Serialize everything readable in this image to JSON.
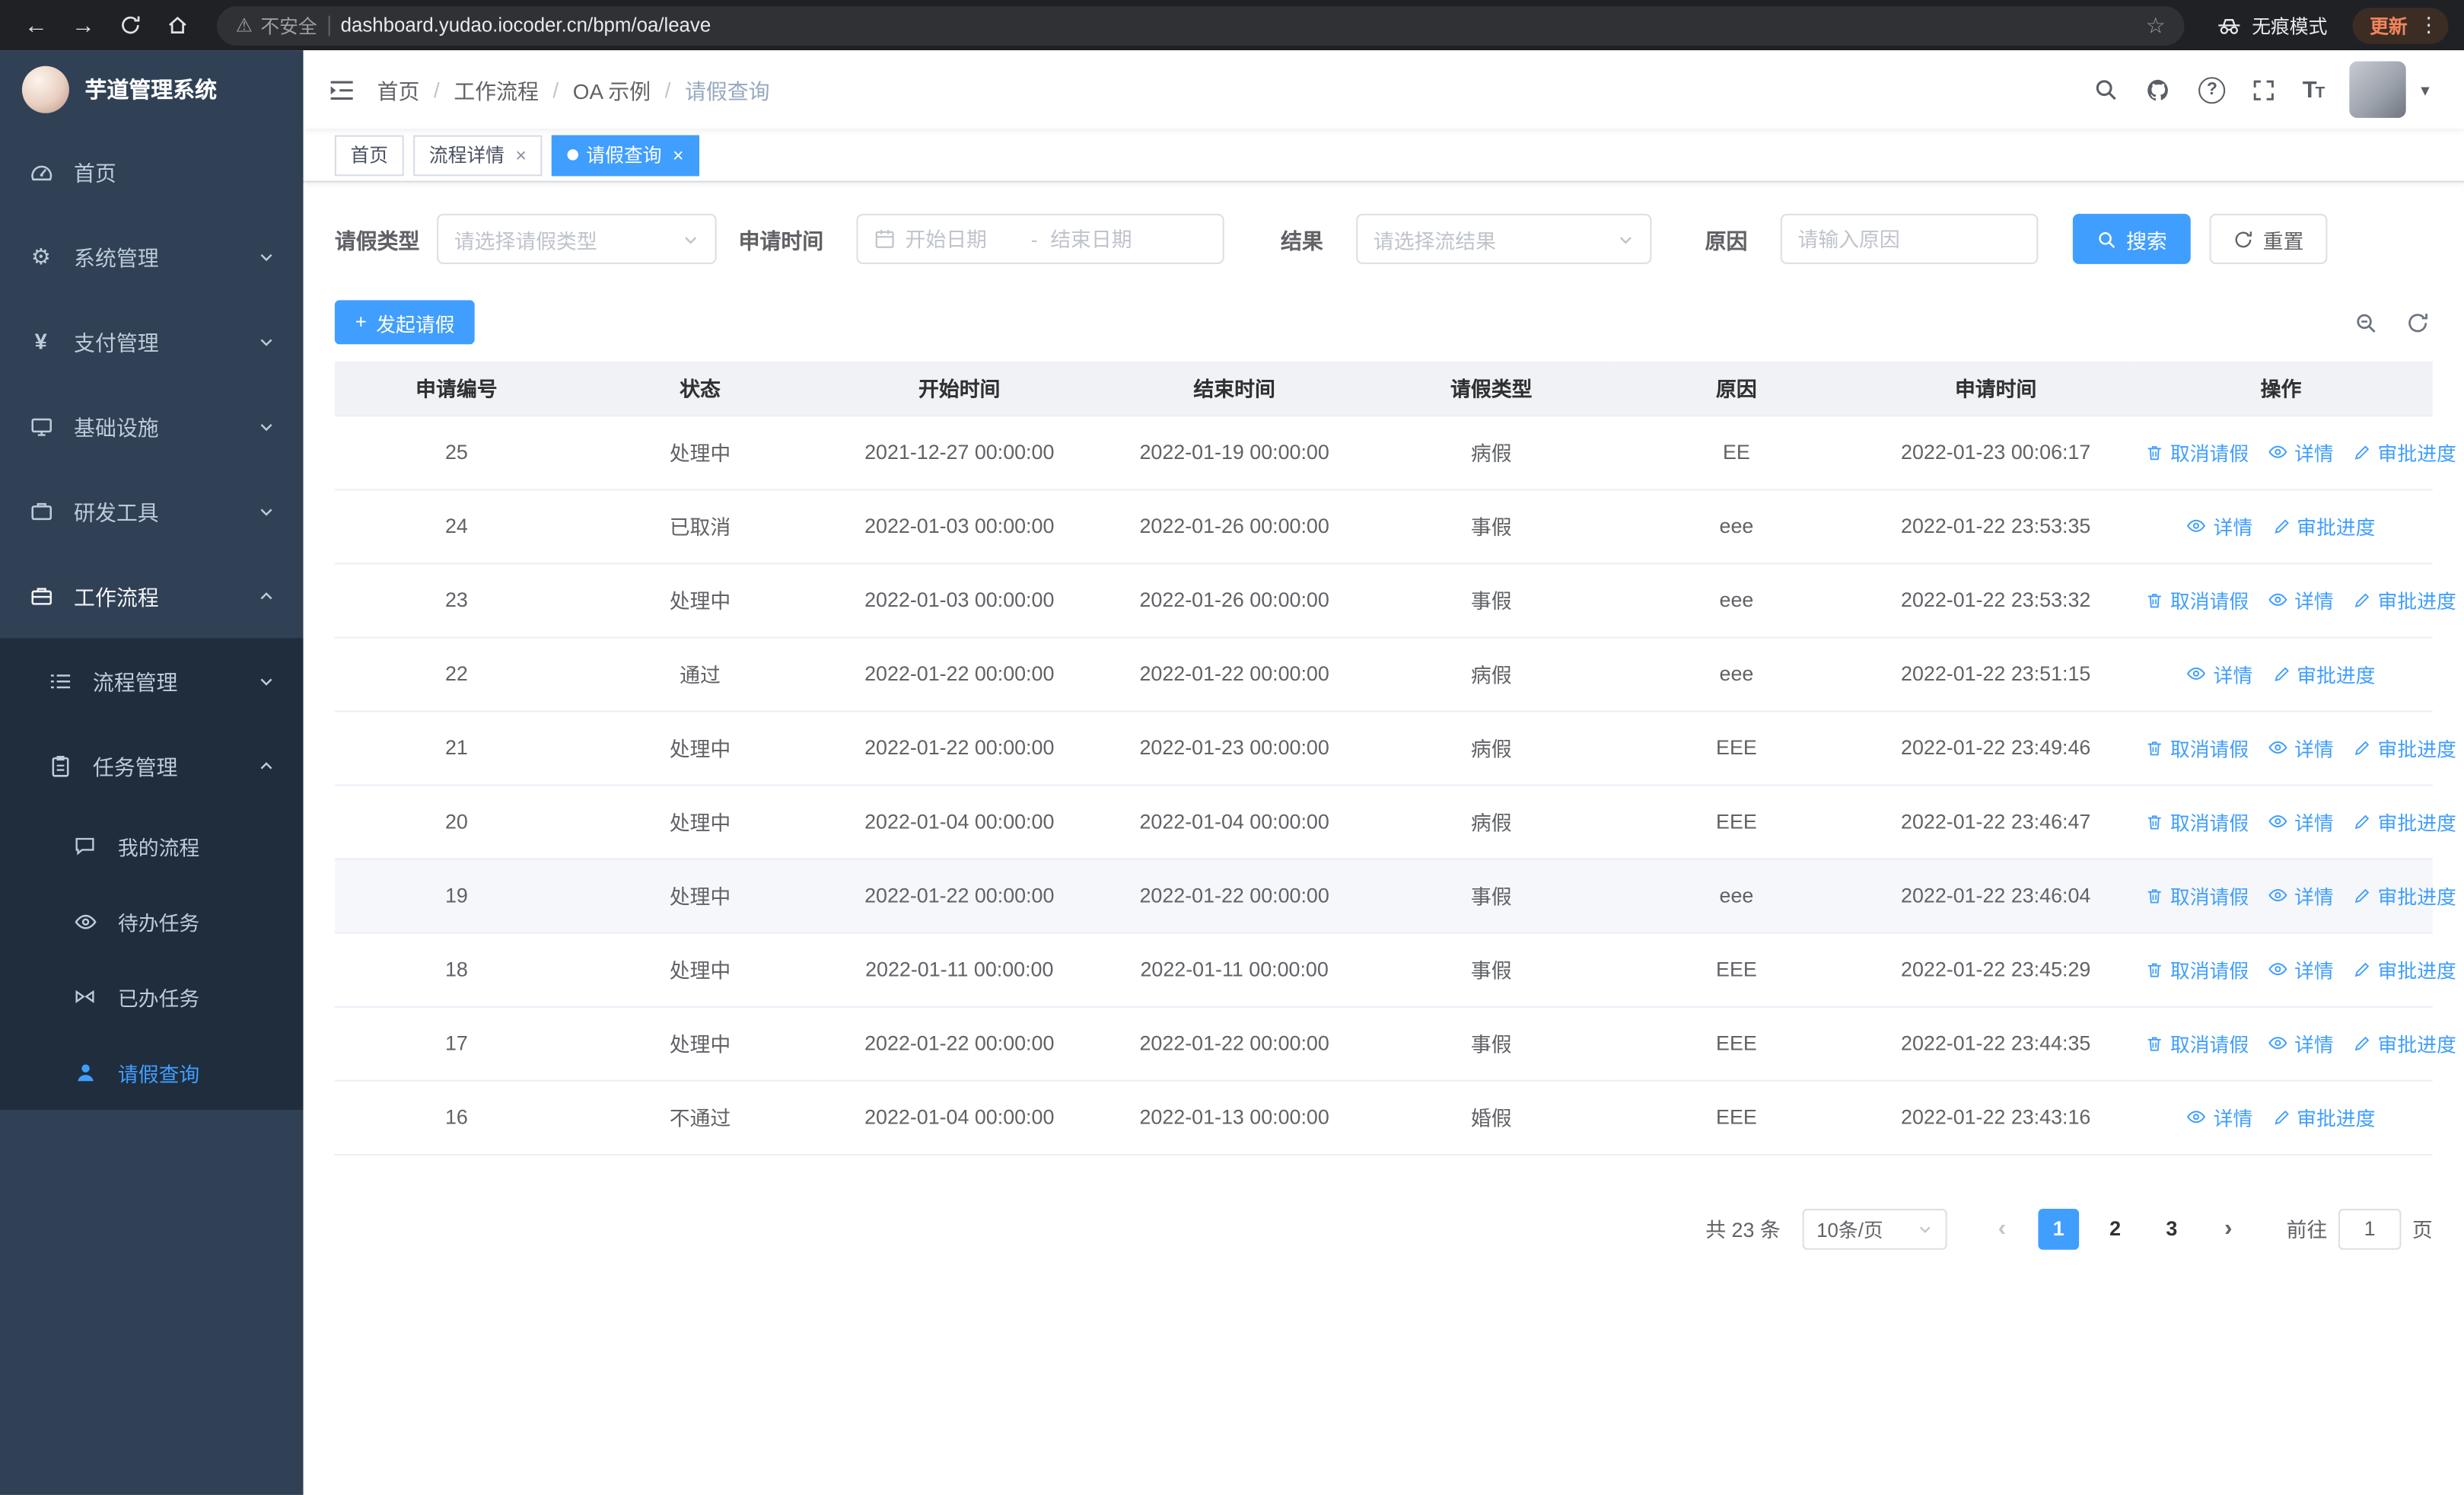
{
  "browser": {
    "security_chip": "不安全",
    "url": "dashboard.yudao.iocoder.cn/bpm/oa/leave",
    "incognito_label": "无痕模式",
    "update_label": "更新"
  },
  "sidebar": {
    "app_title": "芋道管理系统",
    "menu": [
      {
        "label": "首页",
        "icon": "dashboard-icon"
      },
      {
        "label": "系统管理",
        "icon": "gear-icon"
      },
      {
        "label": "支付管理",
        "icon": "payment-icon"
      },
      {
        "label": "基础设施",
        "icon": "infrastructure-icon"
      },
      {
        "label": "研发工具",
        "icon": "tools-icon"
      },
      {
        "label": "工作流程",
        "icon": "workflow-icon"
      }
    ],
    "submenu": [
      {
        "label": "流程管理",
        "icon": "process-list-icon"
      },
      {
        "label": "任务管理",
        "icon": "task-clipboard-icon"
      }
    ],
    "task_children": [
      {
        "label": "我的流程",
        "icon": "chat-icon"
      },
      {
        "label": "待办任务",
        "icon": "eye-icon"
      },
      {
        "label": "已办任务",
        "icon": "bowtie-icon"
      },
      {
        "label": "请假查询",
        "icon": "person-icon"
      }
    ]
  },
  "header": {
    "breadcrumb": [
      "首页",
      "工作流程",
      "OA 示例",
      "请假查询"
    ]
  },
  "tabs": [
    {
      "label": "首页"
    },
    {
      "label": "流程详情"
    },
    {
      "label": "请假查询"
    }
  ],
  "filters": {
    "leave_type_label": "请假类型",
    "leave_type_placeholder": "请选择请假类型",
    "apply_time_label": "申请时间",
    "start_date_placeholder": "开始日期",
    "date_separator": "-",
    "end_date_placeholder": "结束日期",
    "result_label": "结果",
    "result_placeholder": "请选择流结果",
    "reason_label": "原因",
    "reason_placeholder": "请输入原因",
    "search_label": "搜索",
    "reset_label": "重置"
  },
  "toolbar": {
    "create_label": "发起请假"
  },
  "table": {
    "columns": [
      "申请编号",
      "状态",
      "开始时间",
      "结束时间",
      "请假类型",
      "原因",
      "申请时间",
      "操作"
    ],
    "action_labels": {
      "cancel": "取消请假",
      "detail": "详情",
      "progress": "审批进度"
    },
    "rows": [
      {
        "id": "25",
        "status": "处理中",
        "start_time": "2021-12-27 00:00:00",
        "end_time": "2022-01-19 00:00:00",
        "leave_type": "病假",
        "reason": "EE",
        "apply_time": "2022-01-23 00:06:17",
        "actions": [
          "cancel",
          "detail",
          "progress"
        ]
      },
      {
        "id": "24",
        "status": "已取消",
        "start_time": "2022-01-03 00:00:00",
        "end_time": "2022-01-26 00:00:00",
        "leave_type": "事假",
        "reason": "eee",
        "apply_time": "2022-01-22 23:53:35",
        "actions": [
          "detail",
          "progress"
        ]
      },
      {
        "id": "23",
        "status": "处理中",
        "start_time": "2022-01-03 00:00:00",
        "end_time": "2022-01-26 00:00:00",
        "leave_type": "事假",
        "reason": "eee",
        "apply_time": "2022-01-22 23:53:32",
        "actions": [
          "cancel",
          "detail",
          "progress"
        ]
      },
      {
        "id": "22",
        "status": "通过",
        "start_time": "2022-01-22 00:00:00",
        "end_time": "2022-01-22 00:00:00",
        "leave_type": "病假",
        "reason": "eee",
        "apply_time": "2022-01-22 23:51:15",
        "actions": [
          "detail",
          "progress"
        ]
      },
      {
        "id": "21",
        "status": "处理中",
        "start_time": "2022-01-22 00:00:00",
        "end_time": "2022-01-23 00:00:00",
        "leave_type": "病假",
        "reason": "EEE",
        "apply_time": "2022-01-22 23:49:46",
        "actions": [
          "cancel",
          "detail",
          "progress"
        ]
      },
      {
        "id": "20",
        "status": "处理中",
        "start_time": "2022-01-04 00:00:00",
        "end_time": "2022-01-04 00:00:00",
        "leave_type": "病假",
        "reason": "EEE",
        "apply_time": "2022-01-22 23:46:47",
        "actions": [
          "cancel",
          "detail",
          "progress"
        ]
      },
      {
        "id": "19",
        "status": "处理中",
        "start_time": "2022-01-22 00:00:00",
        "end_time": "2022-01-22 00:00:00",
        "leave_type": "事假",
        "reason": "eee",
        "apply_time": "2022-01-22 23:46:04",
        "actions": [
          "cancel",
          "detail",
          "progress"
        ],
        "highlighted": true
      },
      {
        "id": "18",
        "status": "处理中",
        "start_time": "2022-01-11 00:00:00",
        "end_time": "2022-01-11 00:00:00",
        "leave_type": "事假",
        "reason": "EEE",
        "apply_time": "2022-01-22 23:45:29",
        "actions": [
          "cancel",
          "detail",
          "progress"
        ]
      },
      {
        "id": "17",
        "status": "处理中",
        "start_time": "2022-01-22 00:00:00",
        "end_time": "2022-01-22 00:00:00",
        "leave_type": "事假",
        "reason": "EEE",
        "apply_time": "2022-01-22 23:44:35",
        "actions": [
          "cancel",
          "detail",
          "progress"
        ]
      },
      {
        "id": "16",
        "status": "不通过",
        "start_time": "2022-01-04 00:00:00",
        "end_time": "2022-01-13 00:00:00",
        "leave_type": "婚假",
        "reason": "EEE",
        "apply_time": "2022-01-22 23:43:16",
        "actions": [
          "detail",
          "progress"
        ]
      }
    ]
  },
  "pagination": {
    "total_text": "共 23 条",
    "page_size": "10条/页",
    "pages": [
      "1",
      "2",
      "3"
    ],
    "active_page": "1",
    "goto_prefix": "前往",
    "goto_value": "1",
    "goto_suffix": "页"
  },
  "colors": {
    "primary": "#409eff",
    "sidebar_bg": "#304156",
    "sidebar_submenu_bg": "#1f2d3d",
    "active_text": "#409eff",
    "table_header_bg": "#f0f2f5",
    "update_badge_text": "#f0845c"
  }
}
